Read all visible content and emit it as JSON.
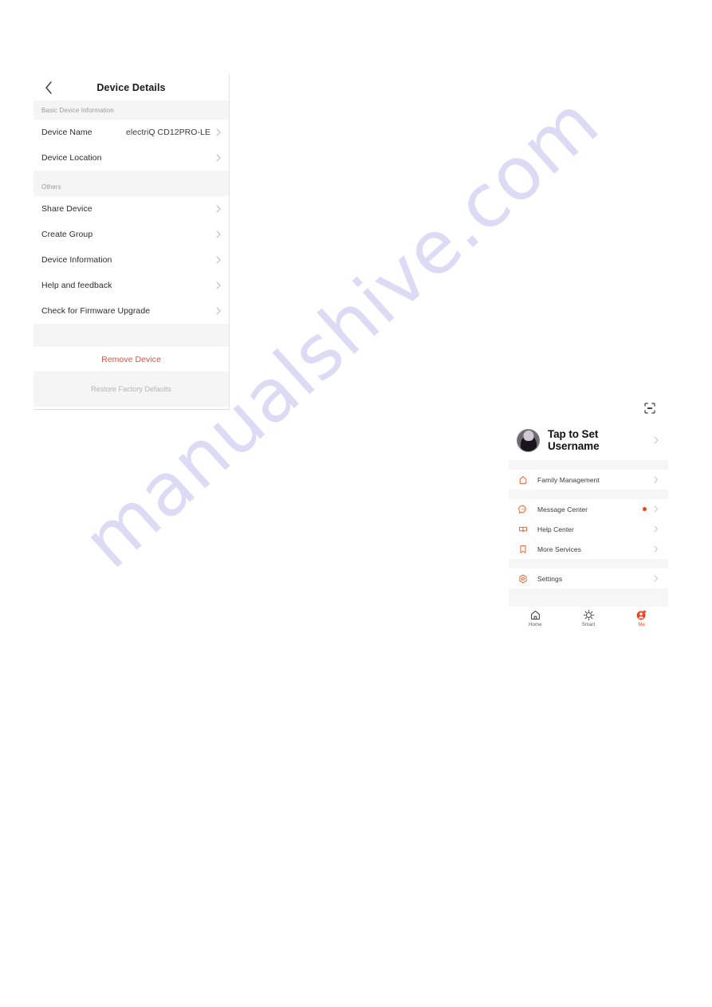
{
  "device_details": {
    "back_icon": "chevron-left-icon",
    "title": "Device Details",
    "sections": [
      {
        "label": "Basic Device Information",
        "rows": [
          {
            "label": "Device Name",
            "value": "electriQ CD12PRO-LE",
            "chevron": "chevron-right-icon"
          },
          {
            "label": "Device Location",
            "value": "",
            "chevron": "chevron-right-icon"
          }
        ]
      },
      {
        "label": "Others",
        "rows": [
          {
            "label": "Share Device",
            "value": "",
            "chevron": "chevron-right-icon"
          },
          {
            "label": "Create Group",
            "value": "",
            "chevron": "chevron-right-icon"
          },
          {
            "label": "Device Information",
            "value": "",
            "chevron": "chevron-right-icon"
          },
          {
            "label": "Help and feedback",
            "value": "",
            "chevron": "chevron-right-icon"
          },
          {
            "label": "Check for Firmware Upgrade",
            "value": "",
            "chevron": "chevron-right-icon"
          }
        ]
      }
    ],
    "remove_label": "Remove Device",
    "remove_color": "#e8503a",
    "restore_label": "Restore Factory Defaults",
    "restore_color": "#b3b3b3"
  },
  "me_screen": {
    "scan_icon": "scan-code-icon",
    "profile": {
      "avatar_icon": "user-avatar-image",
      "username": "Tap to Set Username",
      "chevron": "chevron-right-icon"
    },
    "group_one": [
      {
        "icon": "home-outline-icon",
        "label": "Family Management",
        "badge": false
      }
    ],
    "group_two": [
      {
        "icon": "message-bubble-icon",
        "label": "Message Center",
        "badge": true
      },
      {
        "icon": "help-book-icon",
        "label": "Help Center",
        "badge": false
      },
      {
        "icon": "bookmark-icon",
        "label": "More Services",
        "badge": false
      }
    ],
    "group_three": [
      {
        "icon": "gear-target-icon",
        "label": "Settings",
        "badge": false
      }
    ],
    "accent_color": "#f0622a",
    "badge_color": "#e8461e",
    "tabs": [
      {
        "icon": "home-icon",
        "label": "Home",
        "active": false
      },
      {
        "icon": "smart-sun-icon",
        "label": "Smart",
        "active": false
      },
      {
        "icon": "me-person-icon",
        "label": "Me",
        "active": true
      }
    ]
  },
  "watermark": {
    "text": "manualshive.com",
    "color": "#c9c5ef"
  }
}
